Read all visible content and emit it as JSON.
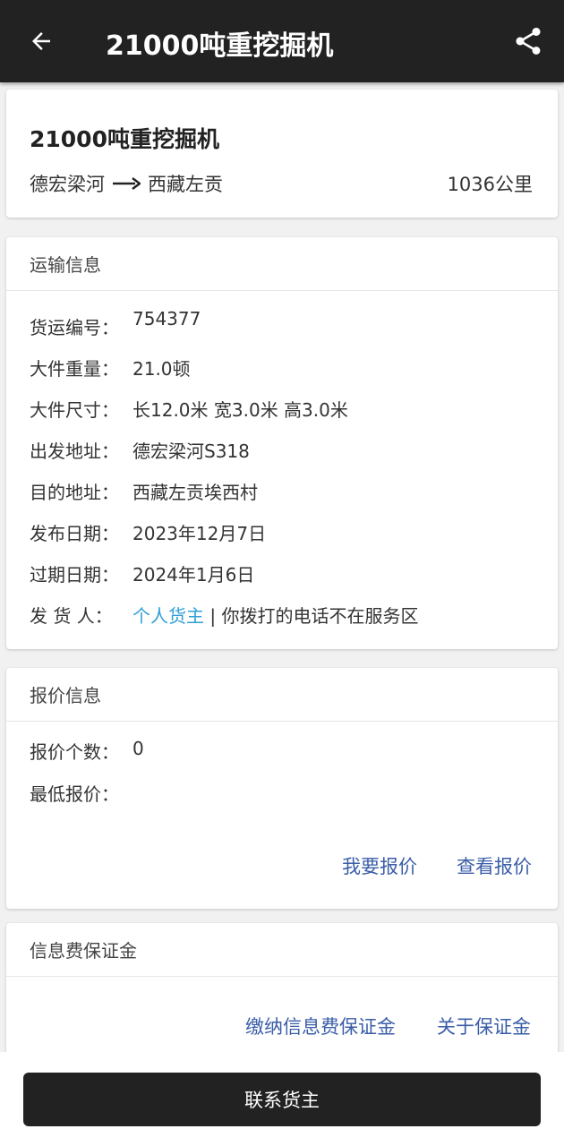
{
  "appbar": {
    "title": "21000吨重挖掘机"
  },
  "summary": {
    "title": "21000吨重挖掘机",
    "from": "德宏梁河",
    "to": "西藏左贡",
    "distance": "1036公里"
  },
  "transport": {
    "header": "运输信息",
    "rows": [
      {
        "label": "货运编号：",
        "value": "754377"
      },
      {
        "label": "大件重量：",
        "value": "21.0顿"
      },
      {
        "label": "大件尺寸：",
        "value": "长12.0米 宽3.0米 高3.0米"
      },
      {
        "label": "出发地址：",
        "value": "德宏梁河S318"
      },
      {
        "label": "目的地址：",
        "value": "西藏左贡埃西村"
      },
      {
        "label": "发布日期：",
        "value": "2023年12月7日"
      },
      {
        "label": "过期日期：",
        "value": "2024年1月6日"
      }
    ],
    "shipper": {
      "label": "发 货 人：",
      "link": "个人货主",
      "separator": " | ",
      "phone": "你拨打的电话不在服务区"
    }
  },
  "quote": {
    "header": "报价信息",
    "count_label": "报价个数：",
    "count_value": "0",
    "lowest_label": "最低报价：",
    "lowest_value": "",
    "action_quote": "我要报价",
    "action_view": "查看报价"
  },
  "deposit": {
    "header": "信息费保证金",
    "action_pay": "缴纳信息费保证金",
    "action_about": "关于保证金"
  },
  "bottom": {
    "contact_label": "联系货主"
  },
  "colors": {
    "appbar_bg": "#222222",
    "link_blue": "#2f9fd6",
    "action_blue": "#3b5ea8",
    "count_red": "#e05050"
  },
  "icons": {
    "back": "arrow-left-icon",
    "share": "share-icon",
    "route": "long-arrow-right-icon"
  }
}
